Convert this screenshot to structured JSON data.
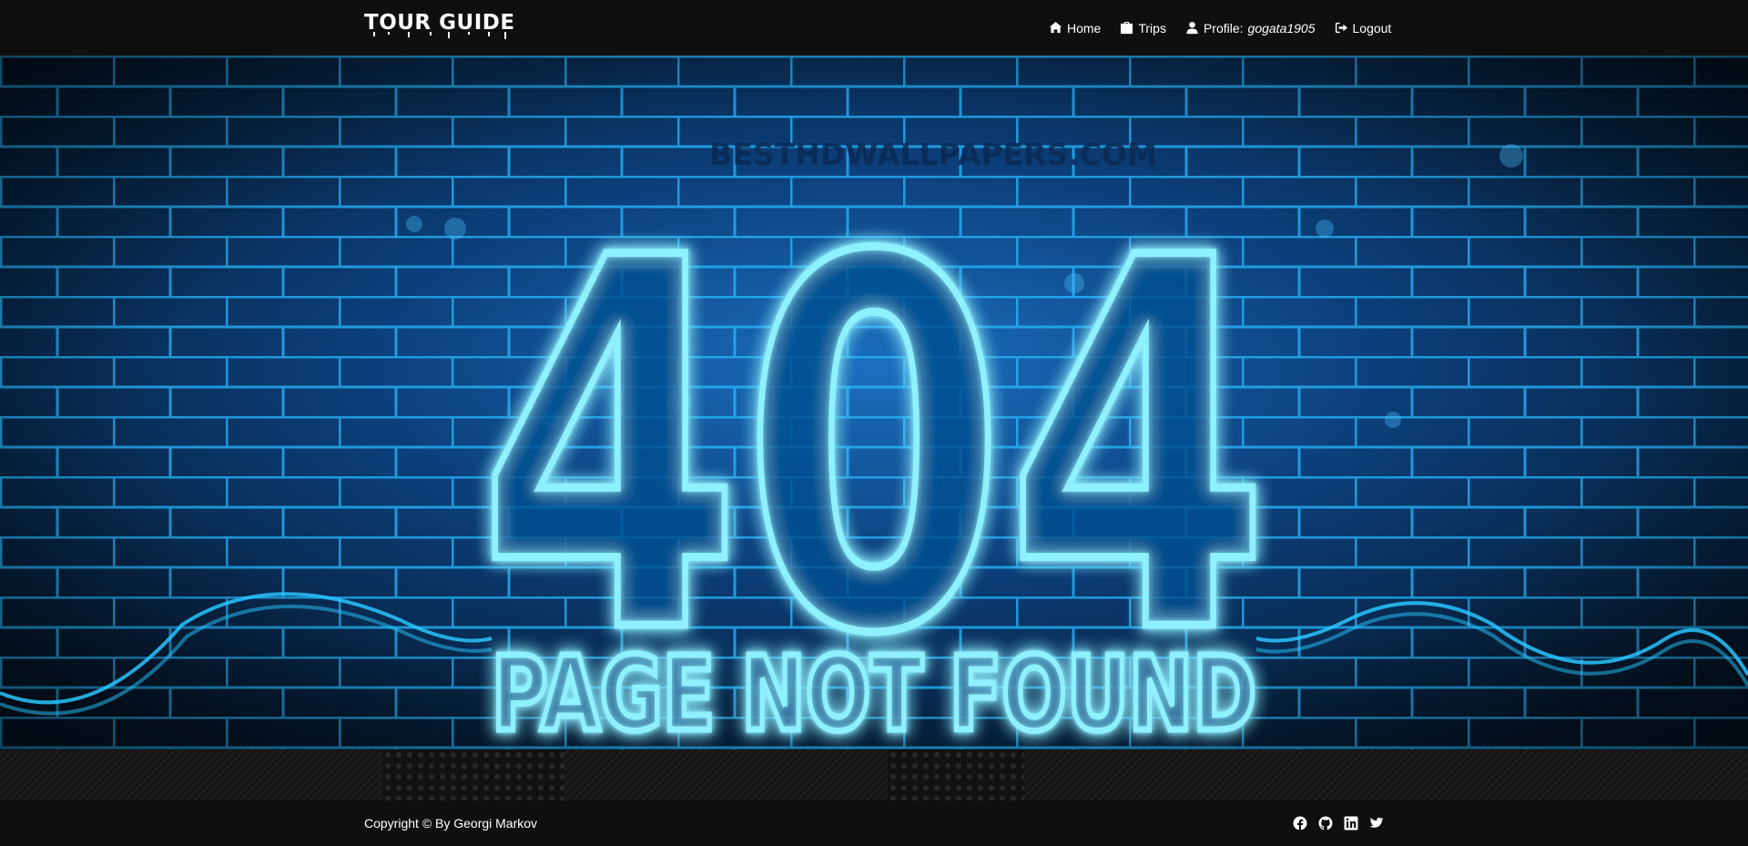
{
  "header": {
    "logo_text": "TOUR GUIDE",
    "nav": {
      "home_label": "Home",
      "trips_label": "Trips",
      "profile_label": "Profile:",
      "profile_user": "gogata1905",
      "logout_label": "Logout"
    }
  },
  "hero": {
    "watermark": "BESTHDWALLPAPERS.COM",
    "code": "404",
    "message": "PAGE NOT FOUND"
  },
  "footer": {
    "copyright": "Copyright © By Georgi Markov",
    "socials": [
      "facebook-icon",
      "github-icon",
      "linkedin-icon",
      "twitter-icon"
    ]
  },
  "colors": {
    "header_bg": "#0f0f0f",
    "wall_bg": "#06223f",
    "mortar_glow": "#1fb3ff",
    "neon": "#7fe6ff",
    "neon_glow": "#00b7ff"
  }
}
